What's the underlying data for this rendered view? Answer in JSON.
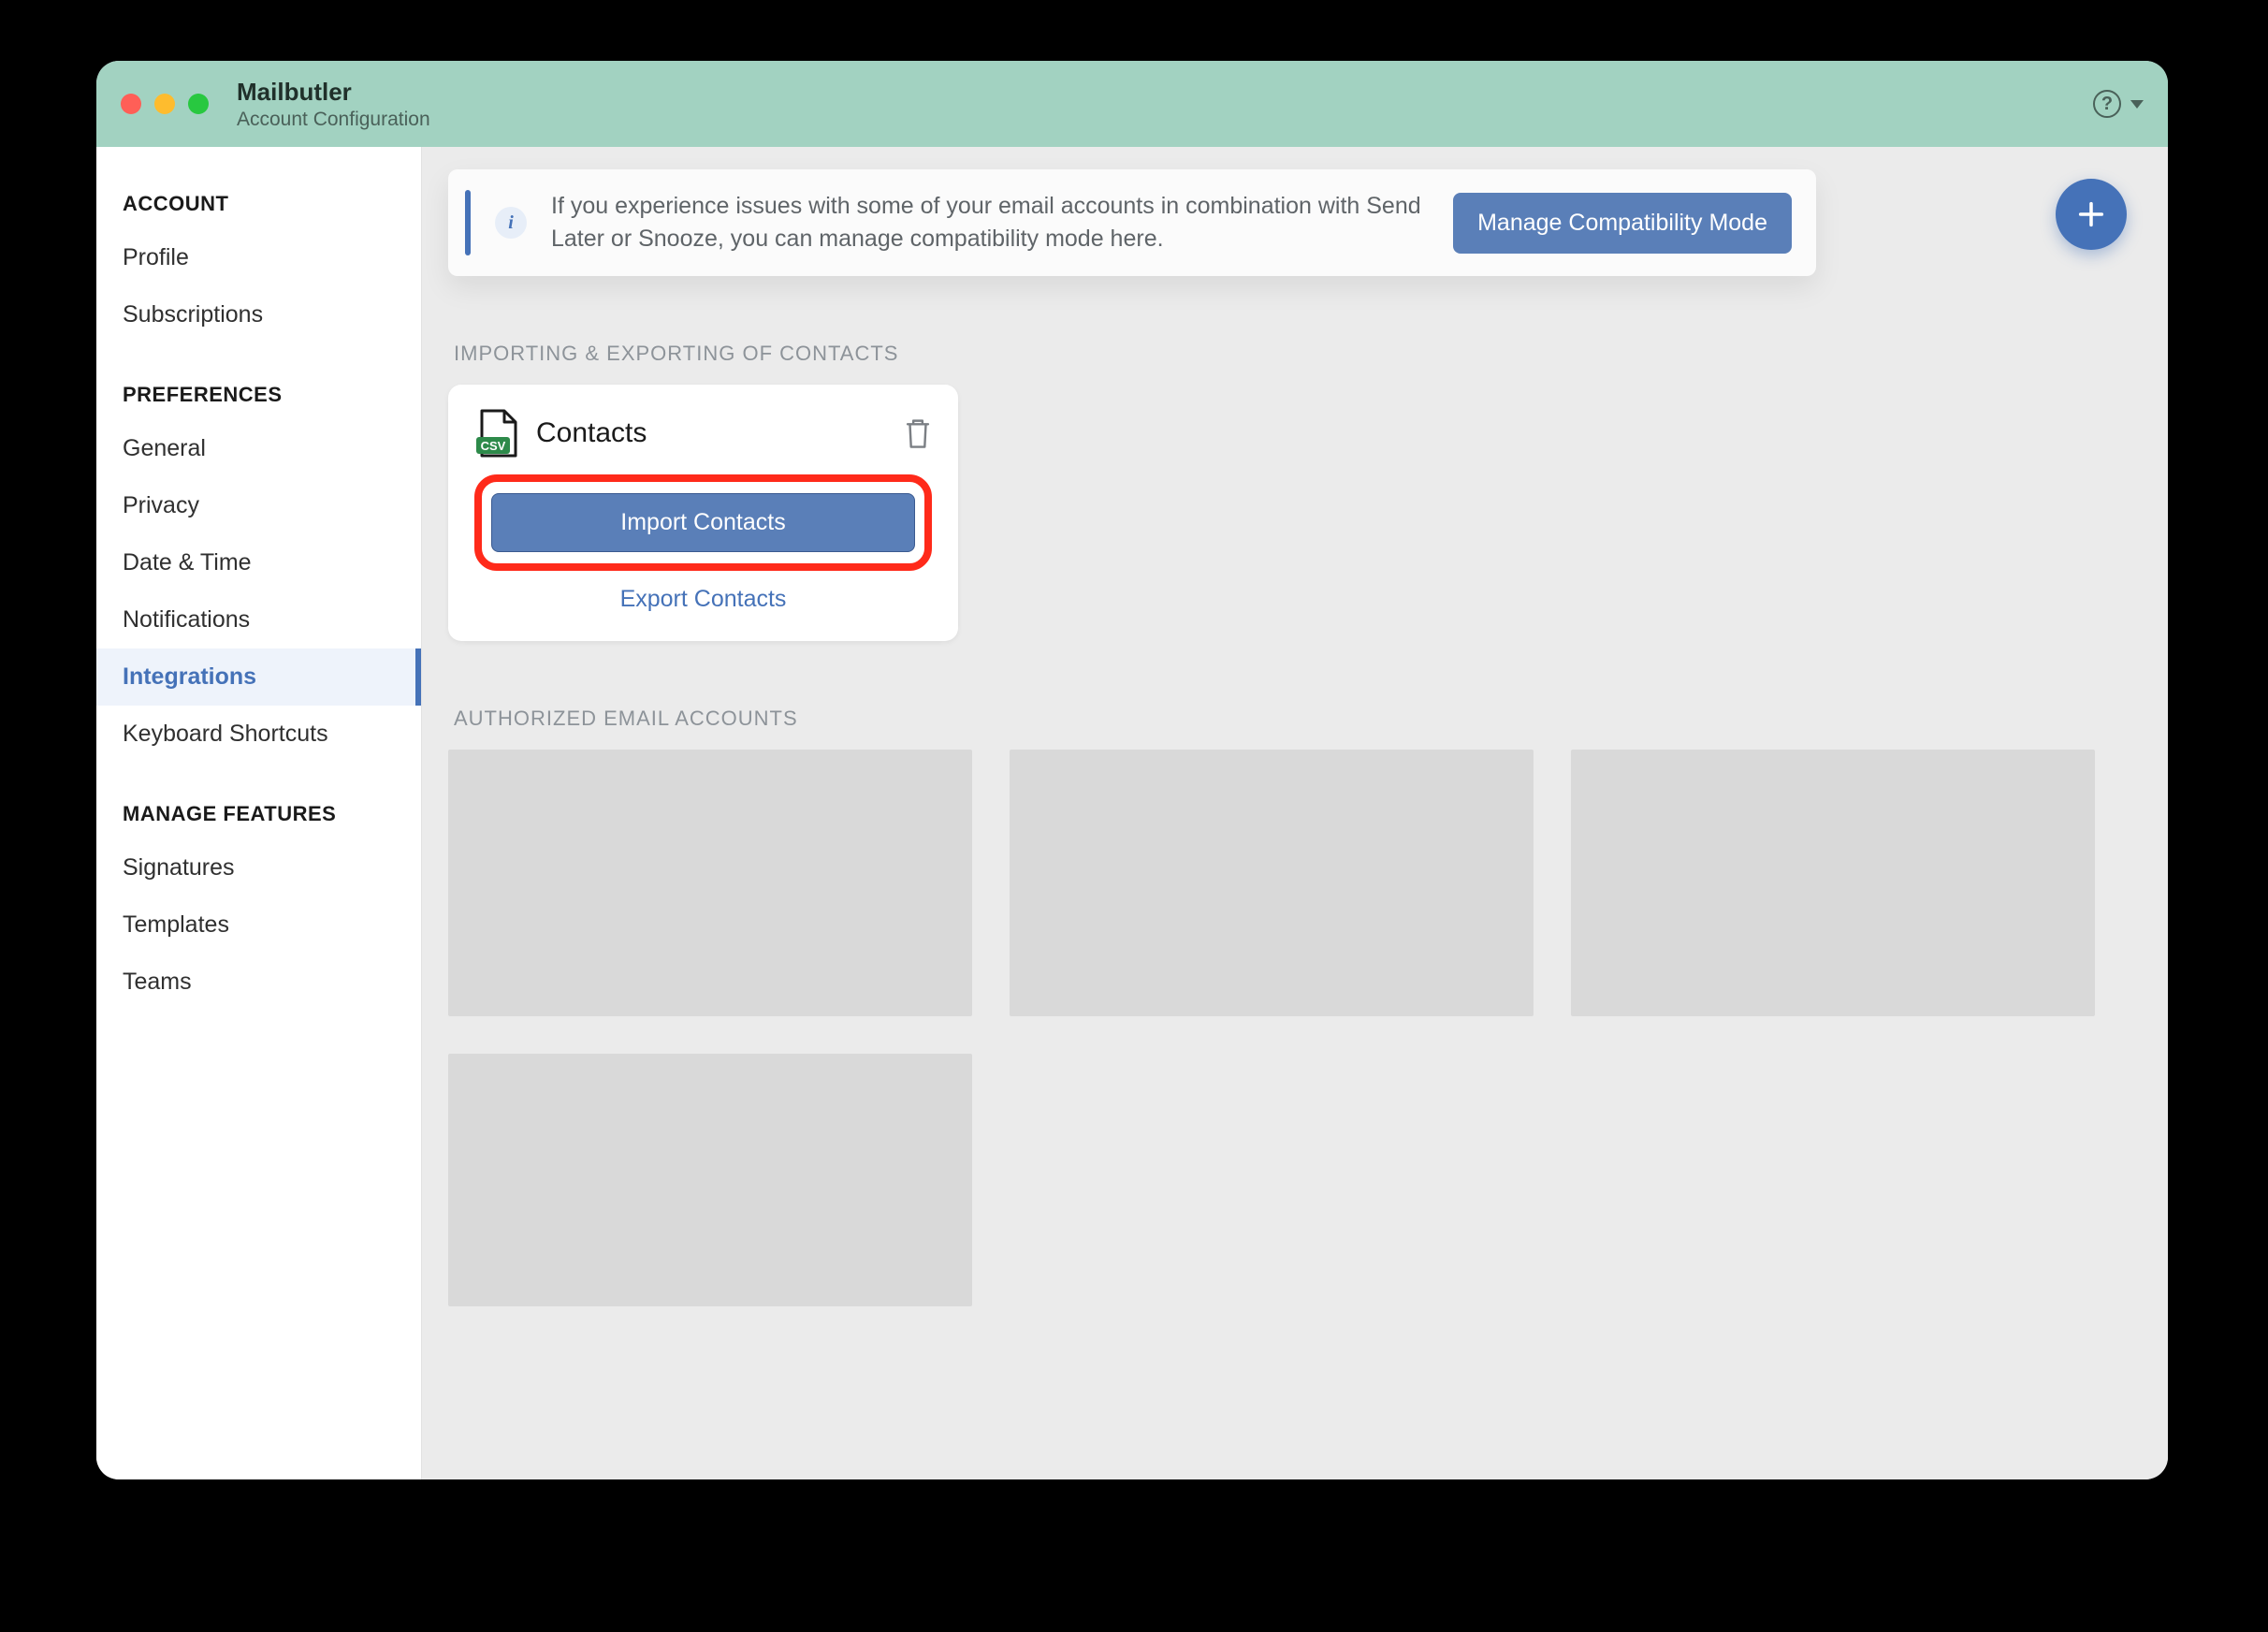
{
  "header": {
    "app_title": "Mailbutler",
    "app_subtitle": "Account Configuration"
  },
  "sidebar": {
    "groups": [
      {
        "heading": "ACCOUNT",
        "items": [
          {
            "label": "Profile",
            "active": false
          },
          {
            "label": "Subscriptions",
            "active": false
          }
        ]
      },
      {
        "heading": "PREFERENCES",
        "items": [
          {
            "label": "General",
            "active": false
          },
          {
            "label": "Privacy",
            "active": false
          },
          {
            "label": "Date & Time",
            "active": false
          },
          {
            "label": "Notifications",
            "active": false
          },
          {
            "label": "Integrations",
            "active": true
          },
          {
            "label": "Keyboard Shortcuts",
            "active": false
          }
        ]
      },
      {
        "heading": "MANAGE FEATURES",
        "items": [
          {
            "label": "Signatures",
            "active": false
          },
          {
            "label": "Templates",
            "active": false
          },
          {
            "label": "Teams",
            "active": false
          }
        ]
      }
    ]
  },
  "banner": {
    "text": "If you experience issues with some of your email accounts in combination with Send Later or Snooze, you can manage compatibility mode here.",
    "button": "Manage Compatibility Mode"
  },
  "sections": {
    "import_export_label": "IMPORTING & EXPORTING OF CONTACTS",
    "authorized_label": "AUTHORIZED EMAIL ACCOUNTS"
  },
  "contacts_card": {
    "title": "Contacts",
    "csv_badge": "CSV",
    "import_button": "Import Contacts",
    "export_link": "Export Contacts"
  },
  "authorized_accounts_count": 4
}
